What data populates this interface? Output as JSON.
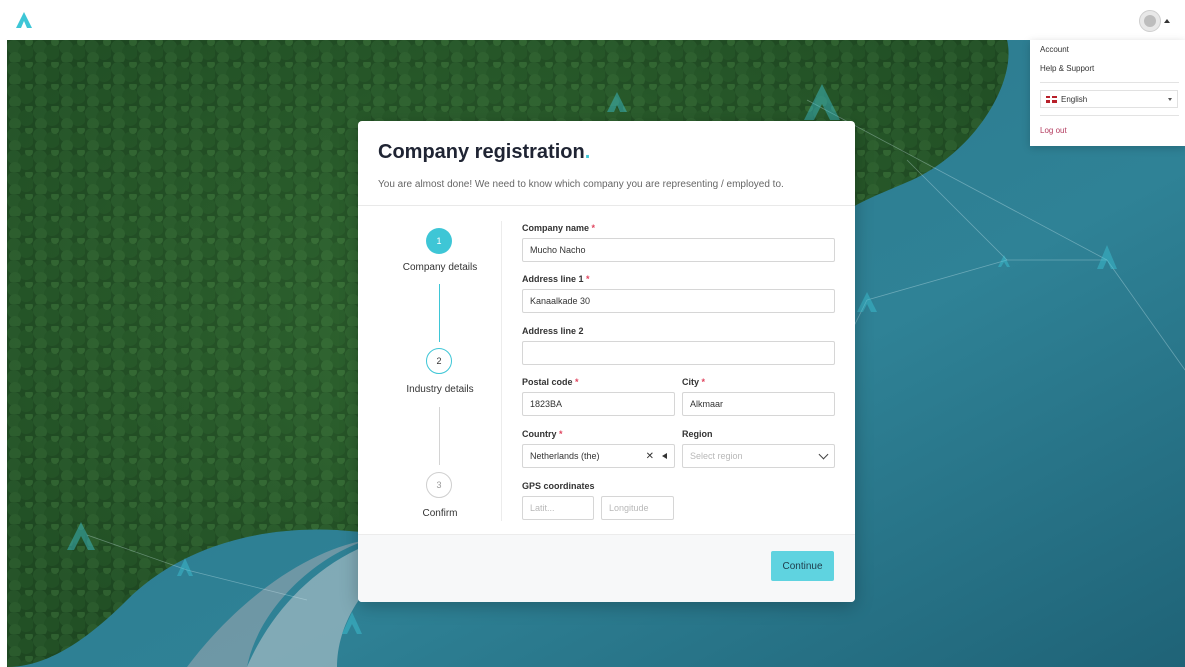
{
  "menu": {
    "account": "Account",
    "help": "Help & Support",
    "language": "English",
    "logout": "Log out"
  },
  "card": {
    "title": "Company registration",
    "title_dot": ".",
    "subtitle": "You are almost done!  We need to know which company you are representing / employed to."
  },
  "steps": [
    {
      "number": "1",
      "label": "Company details",
      "state": "active"
    },
    {
      "number": "2",
      "label": "Industry details",
      "state": "next"
    },
    {
      "number": "3",
      "label": "Confirm",
      "state": "pending"
    }
  ],
  "form": {
    "company_name": {
      "label": "Company name",
      "value": "Mucho Nacho",
      "required": "*"
    },
    "address1": {
      "label": "Address line 1",
      "value": "Kanaalkade 30",
      "required": "*"
    },
    "address2": {
      "label": "Address line 2",
      "value": ""
    },
    "postal_code": {
      "label": "Postal code",
      "value": "1823BA",
      "required": "*"
    },
    "city": {
      "label": "City",
      "value": "Alkmaar",
      "required": "*"
    },
    "country": {
      "label": "Country",
      "value": "Netherlands (the)",
      "required": "*"
    },
    "region": {
      "label": "Region",
      "placeholder": "Select region"
    },
    "gps": {
      "label": "GPS coordinates",
      "lat_placeholder": "Latit...",
      "lon_placeholder": "Longitude"
    }
  },
  "actions": {
    "continue": "Continue"
  },
  "colors": {
    "accent": "#5fd3e0",
    "title_dot": "#3ec6d6",
    "required": "#e0455f",
    "water": "#2e7d8f",
    "forest": "#1f4a24"
  },
  "icons": {
    "logo": "brand-a-logo",
    "avatar": "user-avatar-icon",
    "flag": "uk-flag-icon",
    "clear": "close-icon"
  }
}
